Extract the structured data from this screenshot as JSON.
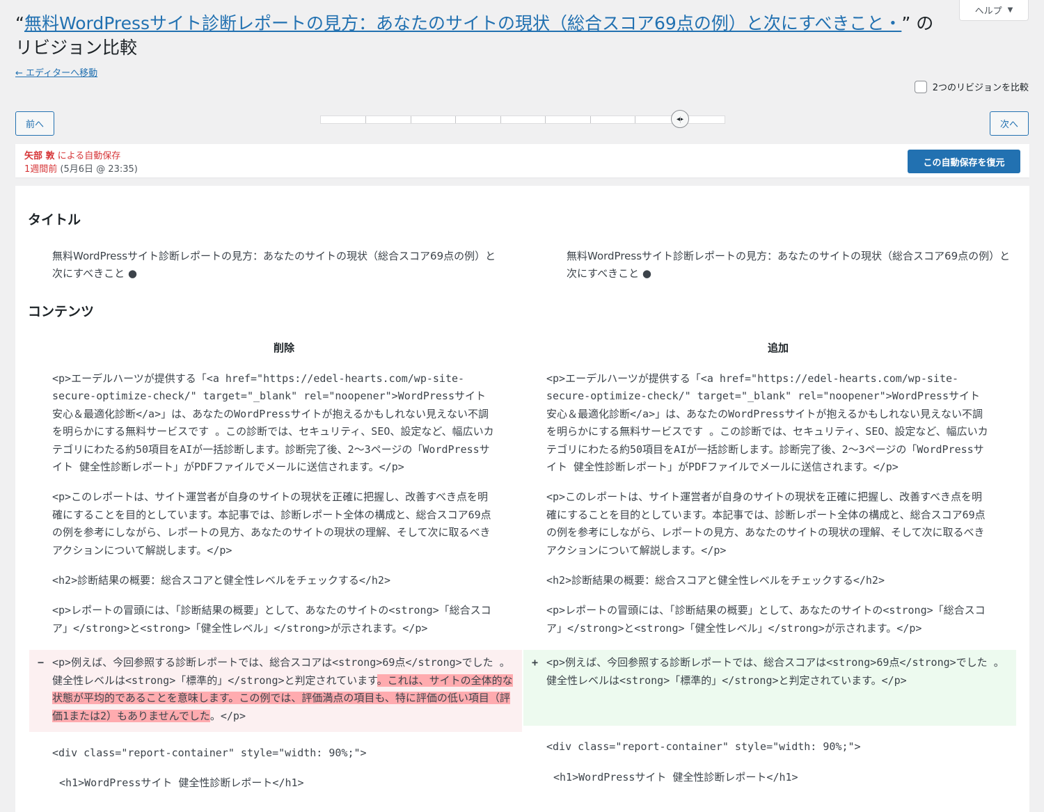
{
  "help": {
    "label": "ヘルプ"
  },
  "header": {
    "title_prefix": "“",
    "title_link": "無料WordPressサイト診断レポートの見方：あなたのサイトの現状（総合スコア69点の例）と次にすべきこと・",
    "title_suffix": "” のリビジョン比較",
    "back_link": "← エディターへ移動"
  },
  "compare_two": {
    "label": "2つのリビジョンを比較",
    "checked": false
  },
  "nav": {
    "prev_label": "前へ",
    "next_label": "次へ"
  },
  "slider": {
    "tick_count": 9,
    "position": 8
  },
  "revision_meta": {
    "author": "矢部 敦",
    "action": " による自動保存",
    "relative_time": "1週間前",
    "date": " (5月6日 @ 23:35)",
    "restore_label": "この自動保存を復元"
  },
  "diff": {
    "title_heading": "タイトル",
    "title_left": "無料WordPressサイト診断レポートの見方：あなたのサイトの現状（総合スコア69点の例）と次にすべきこと ●",
    "title_right": "無料WordPressサイト診断レポートの見方：あなたのサイトの現状（総合スコア69点の例）と次にすべきこと ●",
    "content_heading": "コンテンツ",
    "col_deleted": "削除",
    "col_added": "追加",
    "left_rows": [
      "<p>エーデルハーツが提供する「<a href=\"https://edel-hearts.com/wp-site-secure-optimize-check/\" target=\"_blank\" rel=\"noopener\">WordPressサイト 安心＆最適化診断</a>」は、あなたのWordPressサイトが抱えるかもしれない見えない不調を明らかにする無料サービスです 。この診断では、セキュリティ、SEO、設定など、幅広いカテゴリにわたる約50項目をAIが一括診断します。診断完了後、2〜3ページの「WordPressサイト 健全性診断レポート」がPDFファイルでメールに送信されます。</p>",
      "<p>このレポートは、サイト運営者が自身のサイトの現状を正確に把握し、改善すべき点を明確にすることを目的としています。本記事では、診断レポート全体の構成と、総合スコア69点の例を参考にしながら、レポートの見方、あなたのサイトの現状の理解、そして次に取るべきアクションについて解説します。</p>",
      "<h2>診断結果の概要：総合スコアと健全性レベルをチェックする</h2>",
      "<p>レポートの冒頭には、「診断結果の概要」として、あなたのサイトの<strong>「総合スコア」</strong>と<strong>「健全性レベル」</strong>が示されます。</p>"
    ],
    "deleted_row": {
      "sign": "−",
      "text": "<p>例えば、今回参照する診断レポートでは、総合スコアは<strong>69点</strong>でした 。健全性レベルは<strong>「標準的」</strong>と判定されています",
      "highlight": "。これは、サイトの全体的な状態が平均的であることを意味します。この例では、評価満点の項目も、特に評価の低い項目（評価1または2）もありませんでした",
      "tail": "。</p>"
    },
    "added_row": {
      "sign": "+",
      "text": "<p>例えば、今回参照する診断レポートでは、総合スコアは<strong>69点</strong>でした 。健全性レベルは<strong>「標準的」</strong>と判定されています。</p>"
    },
    "tail_rows": [
      "<div class=\"report-container\" style=\"width: 90%;\">",
      "<h1>WordPressサイト 健全性診断レポート</h1>"
    ],
    "colors": {
      "deleted_bg": "#fcf0f1",
      "deleted_hl": "#ffabaf",
      "added_bg": "#edfaef",
      "accent": "#2271b1"
    }
  }
}
